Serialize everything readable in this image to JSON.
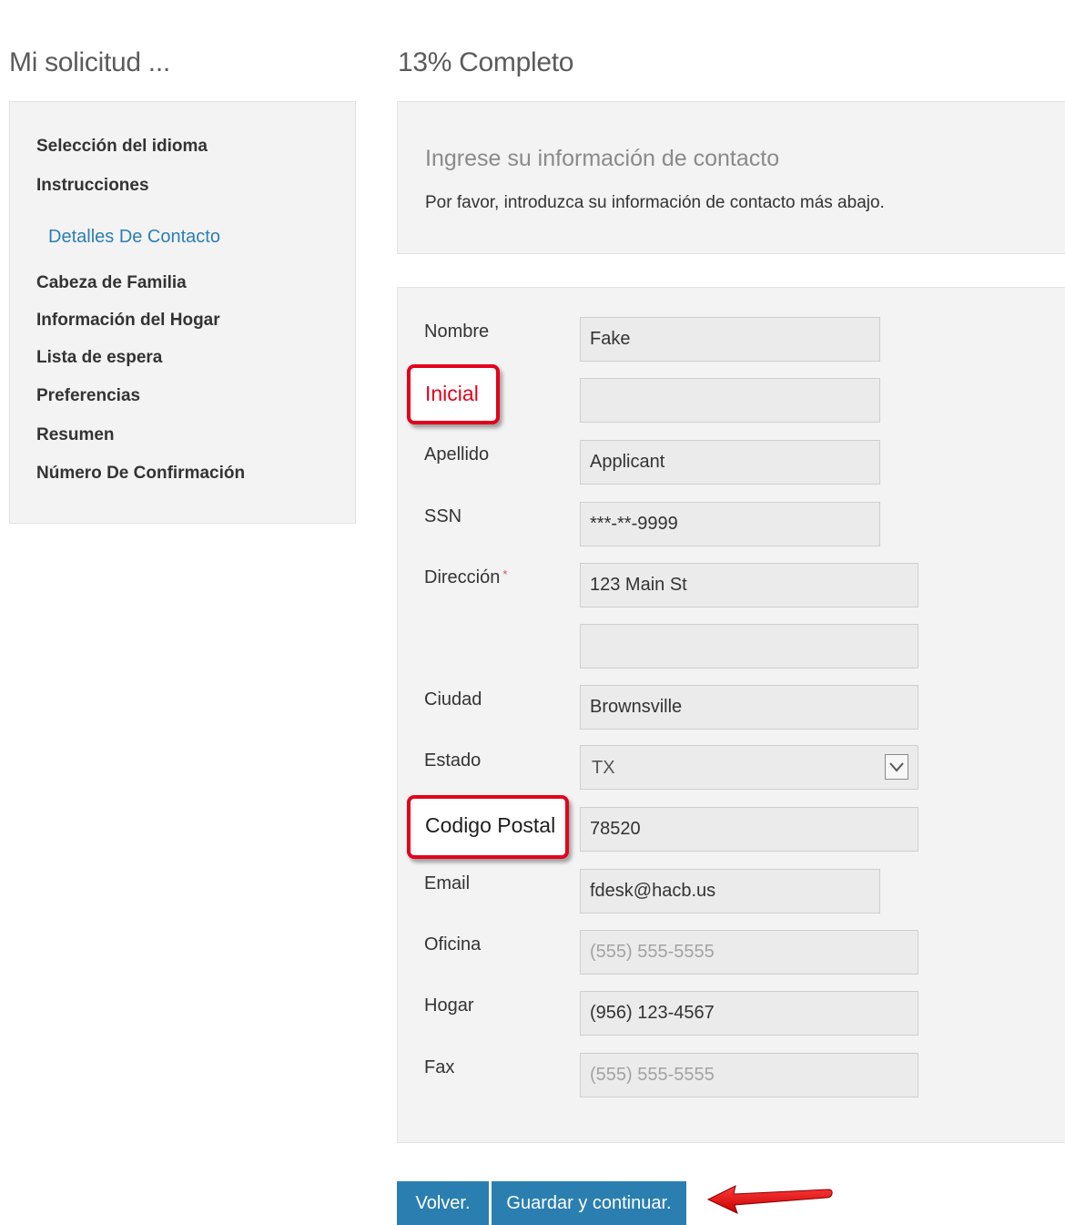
{
  "header": {
    "left_title": "Mi solicitud ...",
    "progress_title": "13% Completo"
  },
  "sidebar": {
    "items": [
      {
        "label": "Selección del idioma"
      },
      {
        "label": "Instrucciones"
      },
      {
        "label": "Detalles De Contacto",
        "active": true
      },
      {
        "label": "Cabeza de Familia"
      },
      {
        "label": "Información del Hogar"
      },
      {
        "label": "Lista de espera"
      },
      {
        "label": "Preferencias"
      },
      {
        "label": "Resumen"
      },
      {
        "label": "Número De Confirmación"
      }
    ]
  },
  "intro": {
    "title": "Ingrese su información de contacto",
    "text": "Por favor, introduzca su información de contacto más abajo."
  },
  "form": {
    "nombre": {
      "label": "Nombre",
      "value": "Fake"
    },
    "inicial": {
      "label": "Inicial",
      "value": ""
    },
    "apellido": {
      "label": "Apellido",
      "value": "Applicant"
    },
    "ssn": {
      "label": "SSN",
      "value": "***-**-9999"
    },
    "direccion": {
      "label": "Dirección",
      "required_mark": "*",
      "value": "123 Main St",
      "value2": ""
    },
    "ciudad": {
      "label": "Ciudad",
      "value": "Brownsville"
    },
    "estado": {
      "label": "Estado",
      "value": "TX"
    },
    "codigo_postal": {
      "label": "Codigo Postal",
      "value": "78520"
    },
    "email": {
      "label": "Email",
      "value": "fdesk@hacb.us"
    },
    "oficina": {
      "label": "Oficina",
      "value": "",
      "placeholder": "(555) 555-5555"
    },
    "hogar": {
      "label": "Hogar",
      "value": "(956) 123-4567"
    },
    "fax": {
      "label": "Fax",
      "value": "",
      "placeholder": "(555) 555-5555"
    }
  },
  "buttons": {
    "back": "Volver.",
    "save_continue": "Guardar y continuar."
  },
  "colors": {
    "accent": "#2a7fb0",
    "highlight": "#e3001b",
    "active_link": "#2b7fb3"
  }
}
